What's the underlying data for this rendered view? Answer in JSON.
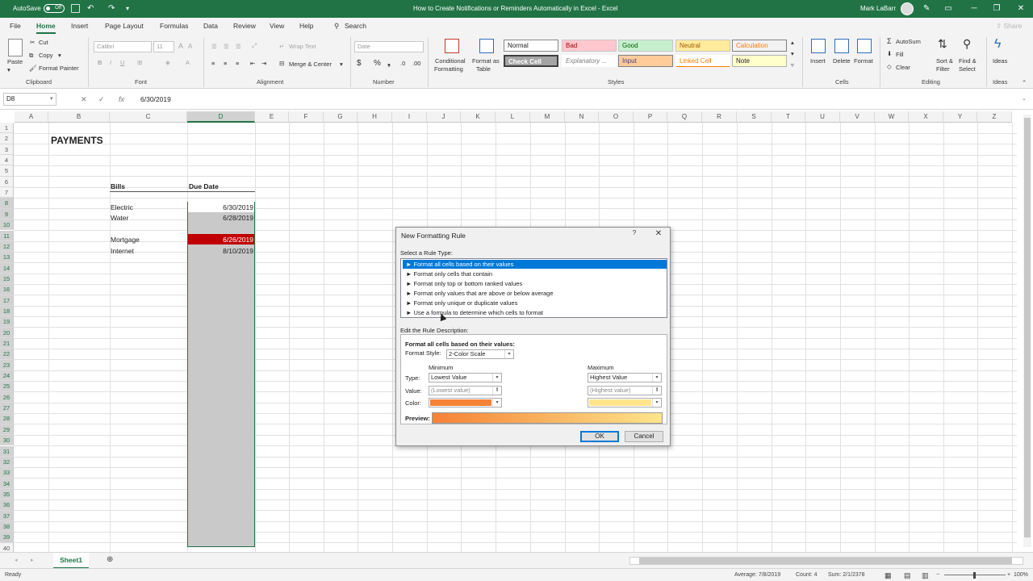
{
  "titlebar": {
    "autosave": "AutoSave",
    "autosave_state": "Off",
    "title": "How to Create Notifications or Reminders Automatically in Excel  -  Excel",
    "user": "Mark LaBarr",
    "controls": {
      "minimize": "─",
      "restore": "❐",
      "close": "✕"
    }
  },
  "menu": {
    "tabs": [
      "File",
      "Home",
      "Insert",
      "Page Layout",
      "Formulas",
      "Data",
      "Review",
      "View",
      "Help"
    ],
    "search": "Search",
    "share": "Share"
  },
  "ribbon": {
    "clipboard": {
      "label": "Clipboard",
      "paste": "Paste",
      "cut": "Cut",
      "copy": "Copy",
      "format_painter": "Format Painter"
    },
    "font": {
      "label": "Font",
      "font_name": "Calibri",
      "font_size": "11"
    },
    "alignment": {
      "label": "Alignment",
      "wrap_text": "Wrap Text",
      "merge_center": "Merge & Center"
    },
    "number": {
      "label": "Number",
      "format": "Date"
    },
    "styles": {
      "label": "Styles",
      "conditional": "Conditional",
      "conditional2": "Formatting",
      "format_as": "Format as",
      "format_as2": "Table",
      "cells": [
        {
          "name": "Normal"
        },
        {
          "name": "Bad"
        },
        {
          "name": "Good"
        },
        {
          "name": "Neutral"
        },
        {
          "name": "Calculation"
        },
        {
          "name": "Check Cell"
        },
        {
          "name": "Explanatory ..."
        },
        {
          "name": "Input"
        },
        {
          "name": "Linked Cell"
        },
        {
          "name": "Note"
        }
      ]
    },
    "cells": {
      "label": "Cells",
      "insert": "Insert",
      "delete": "Delete",
      "format": "Format"
    },
    "editing": {
      "label": "Editing",
      "autosum": "AutoSum",
      "fill": "Fill",
      "clear": "Clear",
      "sort1": "Sort &",
      "sort2": "Filter",
      "find1": "Find &",
      "find2": "Select"
    },
    "ideas": {
      "label": "Ideas",
      "ideas": "Ideas"
    }
  },
  "formula_bar": {
    "name_box": "D8",
    "fx": "fx",
    "value": "6/30/2019"
  },
  "columns": [
    "A",
    "B",
    "C",
    "D",
    "E",
    "F",
    "G",
    "H",
    "I",
    "J",
    "K",
    "L",
    "M",
    "N",
    "O",
    "P",
    "Q",
    "R",
    "S",
    "T",
    "U",
    "V",
    "W",
    "X",
    "Y",
    "Z"
  ],
  "rows": [
    "1",
    "2",
    "3",
    "4",
    "5",
    "6",
    "7",
    "8",
    "9",
    "10",
    "11",
    "12",
    "13",
    "14",
    "15",
    "16",
    "17",
    "18",
    "19",
    "20",
    "21",
    "22",
    "23",
    "24",
    "25",
    "26",
    "27",
    "28",
    "29",
    "30",
    "31",
    "32",
    "33",
    "34",
    "35",
    "36",
    "37",
    "38",
    "39",
    "40"
  ],
  "sheet": {
    "title": "PAYMENTS",
    "bills_header": "Bills",
    "due_header": "Due Date",
    "items": [
      {
        "bill": "Electric",
        "due": "6/30/2019"
      },
      {
        "bill": "Water",
        "due": "6/28/2019"
      },
      {
        "bill": "Mortgage",
        "due": "6/26/2019"
      },
      {
        "bill": "Internet",
        "due": "8/10/2019"
      }
    ],
    "highlight_color": "#c00000"
  },
  "sheet_tabs": {
    "active": "Sheet1"
  },
  "status": {
    "ready": "Ready",
    "average": "Average: 7/8/2019",
    "count": "Count: 4",
    "sum": "Sum: 2/1/2378",
    "zoom": "100%"
  },
  "dialog": {
    "title": "New Formatting Rule",
    "help": "?",
    "close": "✕",
    "select_rule_type": "Select a Rule Type:",
    "rules": [
      "► Format all cells based on their values",
      "► Format only cells that contain",
      "► Format only top or bottom ranked values",
      "► Format only values that are above or below average",
      "► Format only unique or duplicate values",
      "► Use a formula to determine which cells to format"
    ],
    "edit_desc": "Edit the Rule Description:",
    "desc_heading": "Format all cells based on their values:",
    "format_style_label": "Format Style:",
    "format_style": "2-Color Scale",
    "minimum": "Minimum",
    "maximum": "Maximum",
    "type_label": "Type:",
    "value_label": "Value:",
    "color_label": "Color:",
    "min_type": "Lowest Value",
    "max_type": "Highest Value",
    "min_value": "(Lowest value)",
    "max_value": "(Highest value)",
    "min_color": "#f58235",
    "max_color": "#fee58c",
    "preview_label": "Preview:",
    "ok": "OK",
    "cancel": "Cancel"
  }
}
